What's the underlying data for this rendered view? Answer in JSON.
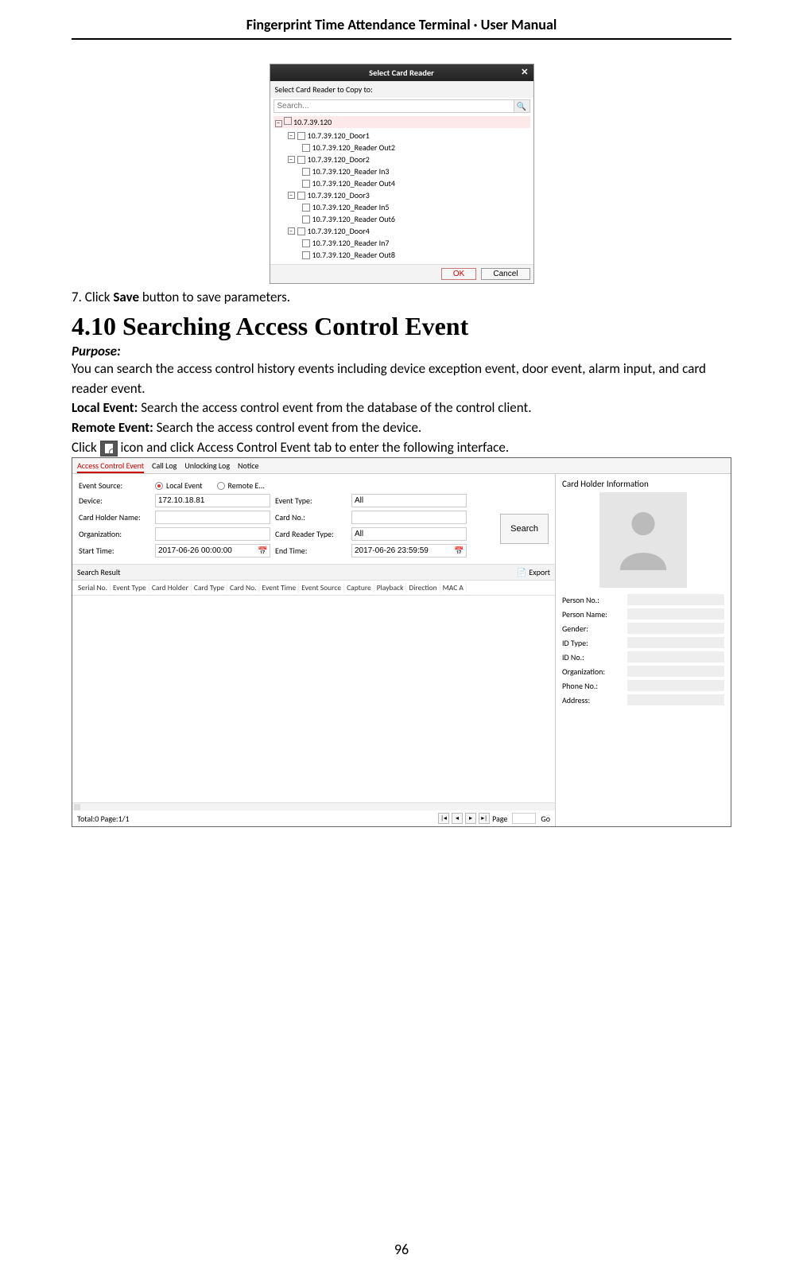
{
  "header": {
    "title": "Fingerprint Time Attendance Terminal · User Manual"
  },
  "page_number": "96",
  "dialog1": {
    "title": "Select Card Reader",
    "subtitle": "Select Card Reader to Copy to:",
    "search_placeholder": "Search...",
    "root": "10.7.39.120",
    "nodes": [
      {
        "name": "10.7.39.120_Door1",
        "children": [
          "10.7.39.120_Reader Out2"
        ]
      },
      {
        "name": "10.7.39.120_Door2",
        "children": [
          "10.7.39.120_Reader In3",
          "10.7.39.120_Reader Out4"
        ]
      },
      {
        "name": "10.7.39.120_Door3",
        "children": [
          "10.7.39.120_Reader In5",
          "10.7.39.120_Reader Out6"
        ]
      },
      {
        "name": "10.7.39.120_Door4",
        "children": [
          "10.7.39.120_Reader In7",
          "10.7.39.120_Reader Out8"
        ]
      }
    ],
    "ok": "OK",
    "cancel": "Cancel"
  },
  "step7_prefix": "7.    Click ",
  "step7_bold": "Save",
  "step7_suffix": " button to save parameters.",
  "section_heading": "4.10 Searching Access Control Event",
  "purpose_label": "Purpose:",
  "purpose_text": "You can search the access control history events including device exception event, door event, alarm input, and card reader event.",
  "local_prefix": "Local Event: ",
  "local_text": "Search the access control event from the database of the control client.",
  "remote_prefix": "Remote Event: ",
  "remote_text": "Search the access control event from the device.",
  "click_prefix": "Click ",
  "click_suffix": " icon and click Access Control Event tab to enter the following interface.",
  "shot2": {
    "tabs": [
      "Access Control Event",
      "Call Log",
      "Unlocking Log",
      "Notice"
    ],
    "labels": {
      "event_source": "Event Source:",
      "local_event": "Local Event",
      "remote_event": "Remote E...",
      "device": "Device:",
      "device_val": "172.10.18.81",
      "event_type": "Event Type:",
      "event_type_val": "All",
      "card_holder_name": "Card Holder Name:",
      "card_no": "Card No.:",
      "organization": "Organization:",
      "card_reader_type": "Card Reader Type:",
      "card_reader_type_val": "All",
      "start_time": "Start Time:",
      "start_time_val": "2017-06-26 00:00:00",
      "end_time": "End Time:",
      "end_time_val": "2017-06-26 23:59:59",
      "search": "Search"
    },
    "result_header": "Search Result",
    "export": "Export",
    "columns": [
      "Serial No.",
      "Event Type",
      "Card Holder",
      "Card Type",
      "Card No.",
      "Event Time",
      "Event Source",
      "Capture",
      "Playback",
      "Direction",
      "MAC A"
    ],
    "pager_status": "Total:0  Page:1/1",
    "page_label": "Page",
    "go": "Go",
    "card_info_title": "Card Holder Information",
    "info_fields": [
      "Person No.:",
      "Person Name:",
      "Gender:",
      "ID Type:",
      "ID No.:",
      "Organization:",
      "Phone No.:",
      "Address:"
    ]
  }
}
